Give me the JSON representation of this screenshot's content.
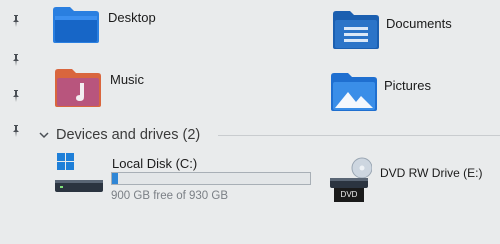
{
  "colors": {
    "background": "#e9ebec",
    "folder_blue": "#1f6fd0",
    "folder_orange": "#e06a3c",
    "progress_fill": "#2f86d6"
  },
  "quick_access": [
    {
      "label": "Desktop",
      "icon": "desktop-folder-icon",
      "pinned": true
    },
    {
      "label": "Documents",
      "icon": "documents-folder-icon",
      "pinned": true
    },
    {
      "label": "Music",
      "icon": "music-folder-icon",
      "pinned": true
    },
    {
      "label": "Pictures",
      "icon": "pictures-folder-icon",
      "pinned": true
    }
  ],
  "devices_section": {
    "title": "Devices and drives (2)"
  },
  "drives": [
    {
      "label": "Local Disk (C:)",
      "free_text": "900 GB free of 930 GB",
      "used_fraction": 0.03,
      "icon": "windows-drive-icon"
    },
    {
      "label": "DVD RW Drive (E:)",
      "badge": "DVD",
      "icon": "dvd-drive-icon"
    }
  ]
}
